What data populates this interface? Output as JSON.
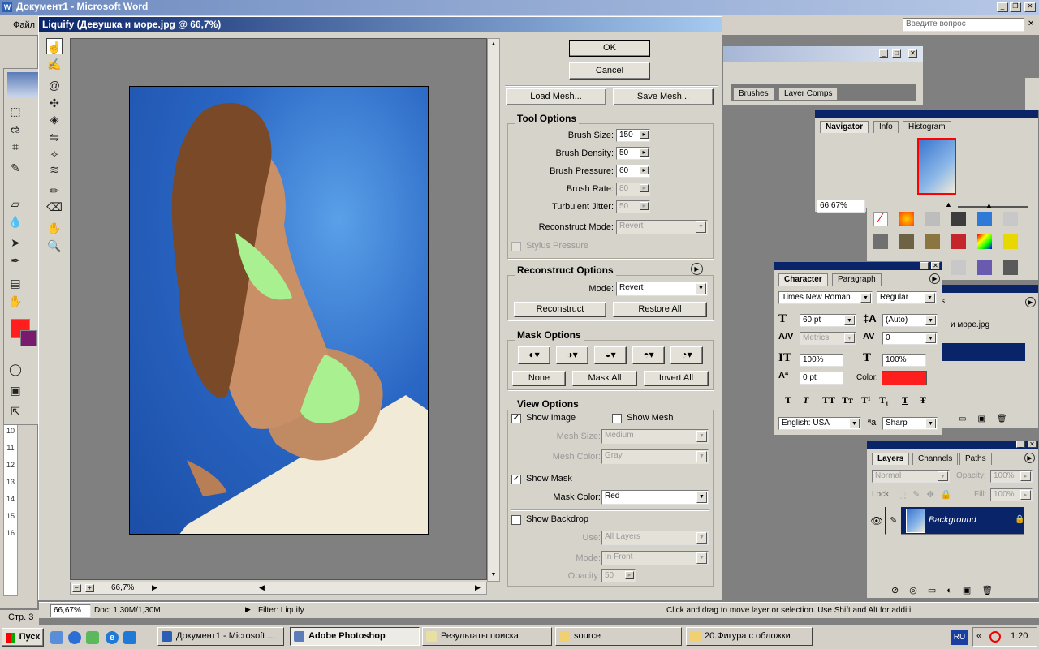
{
  "word": {
    "title": "Документ1 - Microsoft Word",
    "menu_file": "Файл",
    "help_placeholder": "Введите вопрос",
    "status_page": "Стр. 3"
  },
  "liquify": {
    "title": "Liquify (Девушка и море.jpg @ 66,7%)",
    "ok": "OK",
    "cancel": "Cancel",
    "load_mesh": "Load Mesh...",
    "save_mesh": "Save Mesh...",
    "zoom_value": "66,7%",
    "zoom_minus": "−",
    "zoom_plus": "+",
    "tool_options": {
      "title": "Tool Options",
      "brush_size_label": "Brush Size:",
      "brush_size": "150",
      "brush_density_label": "Brush Density:",
      "brush_density": "50",
      "brush_pressure_label": "Brush Pressure:",
      "brush_pressure": "60",
      "brush_rate_label": "Brush Rate:",
      "brush_rate": "80",
      "turbulent_jitter_label": "Turbulent Jitter:",
      "turbulent_jitter": "50",
      "reconstruct_mode_label": "Reconstruct Mode:",
      "reconstruct_mode": "Revert",
      "stylus_pressure": "Stylus Pressure"
    },
    "reconstruct_options": {
      "title": "Reconstruct Options",
      "mode_label": "Mode:",
      "mode": "Revert",
      "reconstruct": "Reconstruct",
      "restore_all": "Restore All"
    },
    "mask_options": {
      "title": "Mask Options",
      "none": "None",
      "mask_all": "Mask All",
      "invert_all": "Invert All"
    },
    "view_options": {
      "title": "View Options",
      "show_image": "Show Image",
      "show_mesh": "Show Mesh",
      "mesh_size_label": "Mesh Size:",
      "mesh_size": "Medium",
      "mesh_color_label": "Mesh Color:",
      "mesh_color": "Gray",
      "show_mask": "Show Mask",
      "mask_color_label": "Mask Color:",
      "mask_color": "Red",
      "show_backdrop": "Show Backdrop",
      "use_label": "Use:",
      "use": "All Layers",
      "mode_label": "Mode:",
      "mode": "In Front",
      "opacity_label": "Opacity:",
      "opacity": "50"
    }
  },
  "photoshop_status": {
    "zoom": "66,67%",
    "doc": "Doc: 1,30M/1,30M",
    "filter": "Filter: Liquify",
    "hint": "Click and drag to move layer or selection.  Use Shift and Alt for additi"
  },
  "brushes_palette": {
    "tab_brushes": "Brushes",
    "tab_layer_comps": "Layer Comps"
  },
  "navigator": {
    "tab_navigator": "Navigator",
    "tab_info": "Info",
    "tab_histogram": "Histogram",
    "zoom": "66,67%"
  },
  "character": {
    "tab_character": "Character",
    "tab_paragraph": "Paragraph",
    "font": "Times New Roman",
    "style": "Regular",
    "size": "60 pt",
    "leading": "(Auto)",
    "kerning": "Metrics",
    "tracking": "0",
    "vscale": "100%",
    "hscale": "100%",
    "baseline": "0 pt",
    "color_label": "Color:",
    "color": "#ff1e1e",
    "language": "English: USA",
    "antialias_prefix": "ªa",
    "antialias": "Sharp",
    "styles": [
      "T",
      "T",
      "TT",
      "Tт",
      "T¹",
      "T₁",
      "T",
      "Ŧ"
    ]
  },
  "history_partial": {
    "tab_fragment": "s",
    "item": "и море.jpg"
  },
  "layers": {
    "tab_layers": "Layers",
    "tab_channels": "Channels",
    "tab_paths": "Paths",
    "blend": "Normal",
    "opacity_label": "Opacity:",
    "opacity": "100%",
    "lock_label": "Lock:",
    "fill_label": "Fill:",
    "fill": "100%",
    "layer_name": "Background"
  },
  "taskbar": {
    "start": "Пуск",
    "items": [
      {
        "label": "Документ1 - Microsoft ...",
        "active": false
      },
      {
        "label": "Adobe Photoshop",
        "active": true
      },
      {
        "label": "Результаты поиска",
        "active": false
      },
      {
        "label": "source",
        "active": false
      },
      {
        "label": "20.Фигура с обложки",
        "active": false
      }
    ],
    "lang": "RU",
    "time": "1:20"
  },
  "colors": {
    "accent_title": "#0a246a",
    "foreground": "#ff1e1e",
    "background": "#7a1a6e",
    "selection": "#0a246a"
  }
}
